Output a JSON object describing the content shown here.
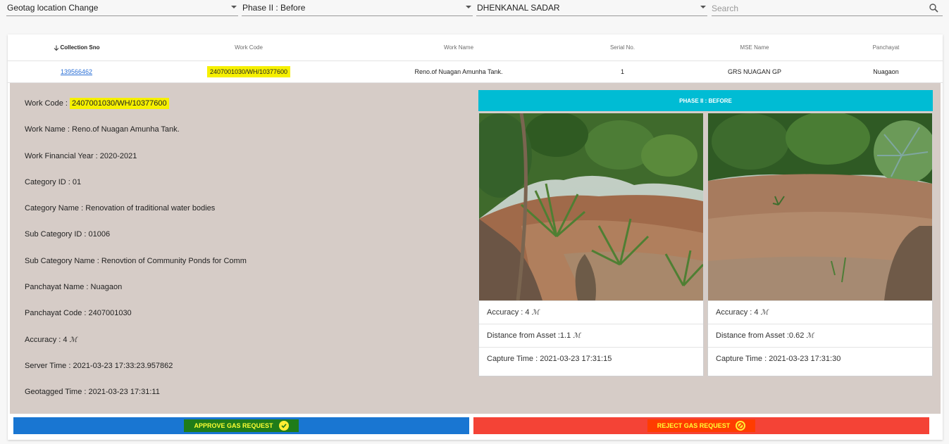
{
  "filters": {
    "type": "Geotag location Change",
    "phase": "Phase II : Before",
    "block": "DHENKANAL SADAR",
    "search_placeholder": "Search"
  },
  "table": {
    "headers": [
      "Collection Sno",
      "Work Code",
      "Work Name",
      "Serial No.",
      "MSE Name",
      "Panchayat"
    ],
    "row": {
      "collection_sno": "139566462",
      "work_code": "2407001030/WH/10377600",
      "work_name": "Reno.of Nuagan Amunha Tank.",
      "serial_no": "1",
      "mse_name": "GRS NUAGAN GP",
      "panchayat": "Nuagaon"
    }
  },
  "detail": {
    "work_code_label": "Work Code : ",
    "work_code": "2407001030/WH/10377600",
    "work_name": "Work Name : Reno.of Nuagan Amunha Tank.",
    "financial_year": "Work Financial Year : 2020-2021",
    "category_id": "Category ID : 01",
    "category_name": "Category Name : Renovation of traditional water bodies",
    "sub_category_id": "Sub Category ID : 01006",
    "sub_category_name": "Sub Category Name : Renovtion of Community Ponds for Comm",
    "panchayat_name": "Panchayat Name : Nuagaon",
    "panchayat_code": "Panchayat Code : 2407001030",
    "accuracy_label": "Accuracy : 4 ",
    "server_time": "Server Time : 2021-03-23 17:33:23.957862",
    "geotagged_time": "Geotagged Time : 2021-03-23 17:31:11",
    "meter_symbol": "ℳ"
  },
  "phase_title": "PHASE II : BEFORE",
  "photos": [
    {
      "accuracy": "Accuracy : 4 ",
      "distance": "Distance from Asset :1.1 ",
      "capture": "Capture Time : 2021-03-23 17:31:15"
    },
    {
      "accuracy": "Accuracy : 4 ",
      "distance": "Distance from Asset :0.62 ",
      "capture": "Capture Time : 2021-03-23 17:31:30"
    }
  ],
  "actions": {
    "approve": "APPROVE GAS REQUEST",
    "reject": "REJECT GAS REQUEST"
  },
  "colors": {
    "accent": "#00bcd4",
    "approve": "#1976d2",
    "reject": "#f44336",
    "highlight": "#f6f000"
  }
}
